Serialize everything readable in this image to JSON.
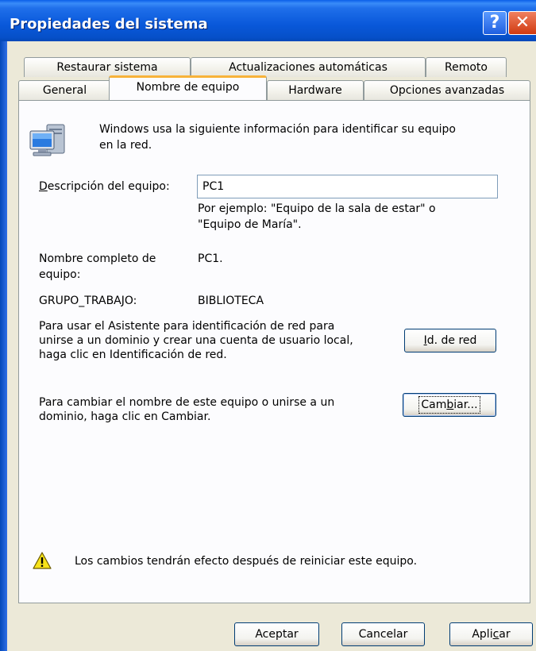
{
  "window": {
    "title": "Propiedades del sistema",
    "help_glyph": "?",
    "close_glyph": "✕"
  },
  "tabs_row1": [
    {
      "label": "Restaurar sistema"
    },
    {
      "label": "Actualizaciones automáticas"
    },
    {
      "label": "Remoto"
    }
  ],
  "tabs_row2": [
    {
      "label": "General"
    },
    {
      "label": "Nombre de equipo",
      "active": true
    },
    {
      "label": "Hardware"
    },
    {
      "label": "Opciones avanzadas"
    }
  ],
  "panel": {
    "intro_line1": "Windows usa la siguiente información para identificar su equipo",
    "intro_line2": "en la red.",
    "description_label_prefix": "",
    "description_label_mnemonic": "D",
    "description_label_rest": "escripción del equipo:",
    "description_value": "PC1",
    "example_line1": "Por ejemplo: \"Equipo de la sala de estar\" o",
    "example_line2": "\"Equipo de María\".",
    "fullname_label_line1": "Nombre completo de",
    "fullname_label_line2": "equipo:",
    "fullname_value": "PC1.",
    "workgroup_label": "GRUPO_TRABAJO:",
    "workgroup_value": "BIBLIOTECA",
    "network_text_line1": "Para usar el Asistente para identificación de red para",
    "network_text_line2": "unirse a un dominio y crear una cuenta de usuario local,",
    "network_text_line3": "haga clic en Identificación de red.",
    "network_button_mnemonic": "I",
    "network_button_rest": "d. de red",
    "change_text_line1": "Para cambiar el nombre de este equipo o unirse a un",
    "change_text_line2": "dominio, haga clic en Cambiar.",
    "change_button_prefix": "Cam",
    "change_button_mnemonic": "b",
    "change_button_rest": "iar...",
    "warning_text": "Los cambios tendrán efecto después de reiniciar este equipo."
  },
  "footer": {
    "accept_label": "Aceptar",
    "cancel_label": "Cancelar",
    "apply_prefix": "Apli",
    "apply_mnemonic": "c",
    "apply_rest": "ar"
  },
  "icons": {
    "computer": "computer-network-icon",
    "warning": "warning-icon",
    "help": "help-icon",
    "close": "close-icon"
  },
  "colors": {
    "titlebar": "#0A58DA",
    "dialog_bg": "#ECE9D8",
    "panel_bg": "#FCFCFE",
    "active_tab_accent": "#F7B33A",
    "close_button": "#D03A10"
  }
}
